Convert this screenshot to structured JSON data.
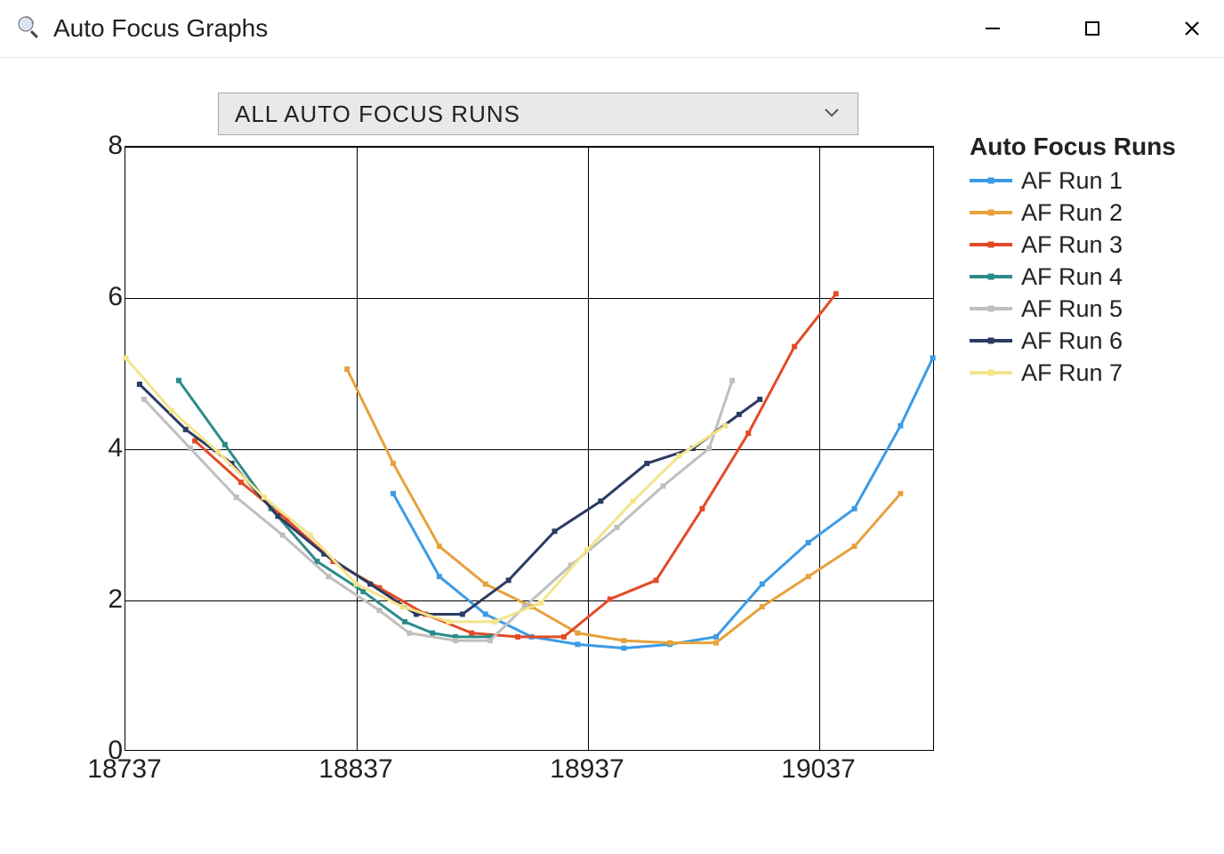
{
  "window": {
    "title": "Auto Focus Graphs",
    "buttons": {
      "minimize": "—",
      "maximize": "▢",
      "close": "✕"
    }
  },
  "dropdown": {
    "selected": "ALL AUTO FOCUS RUNS"
  },
  "legend": {
    "title": "Auto Focus Runs",
    "items": [
      "AF Run 1",
      "AF Run 2",
      "AF Run 3",
      "AF Run 4",
      "AF Run 5",
      "AF Run 6",
      "AF Run 7"
    ]
  },
  "colors": {
    "AF Run 1": "#3b9be6",
    "AF Run 2": "#e6a23c",
    "AF Run 3": "#e24b26",
    "AF Run 4": "#2d8a8a",
    "AF Run 5": "#bfbfbf",
    "AF Run 6": "#2b3b63",
    "AF Run 7": "#f3e48b"
  },
  "chart_data": {
    "type": "line",
    "xlabel": "",
    "ylabel": "",
    "xlim": [
      18737,
      19087
    ],
    "ylim": [
      0,
      8
    ],
    "xticks": [
      18737,
      18837,
      18937,
      19037
    ],
    "yticks": [
      0,
      2,
      4,
      6,
      8
    ],
    "series": [
      {
        "name": "AF Run 1",
        "x": [
          18853,
          18873,
          18893,
          18913,
          18933,
          18953,
          18973,
          18993,
          19013,
          19033,
          19053,
          19073,
          19087
        ],
        "y": [
          3.4,
          2.3,
          1.8,
          1.5,
          1.4,
          1.35,
          1.4,
          1.5,
          2.2,
          2.75,
          3.2,
          4.3,
          5.2
        ]
      },
      {
        "name": "AF Run 2",
        "x": [
          18833,
          18853,
          18873,
          18893,
          18913,
          18933,
          18953,
          18973,
          18993,
          19013,
          19033,
          19053,
          19073
        ],
        "y": [
          5.05,
          3.8,
          2.7,
          2.2,
          1.9,
          1.55,
          1.45,
          1.42,
          1.42,
          1.9,
          2.3,
          2.7,
          3.4
        ]
      },
      {
        "name": "AF Run 3",
        "x": [
          18767,
          18787,
          18807,
          18827,
          18847,
          18867,
          18887,
          18907,
          18927,
          18947,
          18967,
          18987,
          19007,
          19027,
          19045
        ],
        "y": [
          4.1,
          3.55,
          3.05,
          2.5,
          2.15,
          1.8,
          1.55,
          1.5,
          1.5,
          2.0,
          2.25,
          3.2,
          4.2,
          5.35,
          6.05
        ]
      },
      {
        "name": "AF Run 4",
        "x": [
          18760,
          18780,
          18800,
          18820,
          18840,
          18858,
          18870,
          18880,
          18895
        ],
        "y": [
          4.9,
          4.05,
          3.2,
          2.5,
          2.1,
          1.7,
          1.55,
          1.5,
          1.5
        ]
      },
      {
        "name": "AF Run 5",
        "x": [
          18745,
          18765,
          18785,
          18805,
          18825,
          18847,
          18860,
          18880,
          18895,
          18910,
          18930,
          18950,
          18970,
          18990,
          19000
        ],
        "y": [
          4.65,
          4.0,
          3.35,
          2.85,
          2.3,
          1.85,
          1.55,
          1.45,
          1.45,
          1.9,
          2.45,
          2.95,
          3.5,
          4.0,
          4.9
        ]
      },
      {
        "name": "AF Run 6",
        "x": [
          18743,
          18763,
          18783,
          18803,
          18823,
          18843,
          18863,
          18883,
          18903,
          18923,
          18943,
          18963,
          18983,
          19003,
          19012
        ],
        "y": [
          4.85,
          4.25,
          3.8,
          3.1,
          2.6,
          2.2,
          1.8,
          1.8,
          2.25,
          2.9,
          3.3,
          3.8,
          4.0,
          4.45,
          4.65
        ]
      },
      {
        "name": "AF Run 7",
        "x": [
          18737,
          18757,
          18777,
          18797,
          18817,
          18837,
          18857,
          18877,
          18897,
          18917,
          18937,
          18957,
          18977,
          18997
        ],
        "y": [
          5.2,
          4.5,
          3.95,
          3.35,
          2.85,
          2.2,
          1.9,
          1.7,
          1.7,
          1.95,
          2.65,
          3.3,
          3.9,
          4.3
        ]
      }
    ]
  }
}
